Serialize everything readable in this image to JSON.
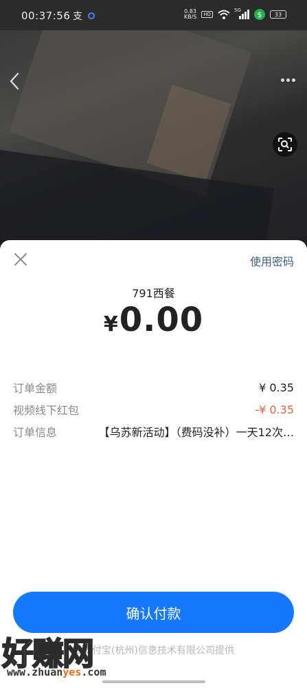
{
  "status_bar": {
    "time": "00:37:56",
    "app_indicator": "支",
    "net_speed": "0.83",
    "net_unit": "KB/S",
    "hd_badge": "HD",
    "signal_label": "5G",
    "battery": "33"
  },
  "camera": {
    "back_icon": "chevron-left-icon",
    "more_icon": "more-dots-icon",
    "scan_icon": "scan-search-icon"
  },
  "sheet": {
    "close_icon": "close-icon",
    "use_password_label": "使用密码",
    "merchant_name": "791西餐",
    "currency_symbol": "¥",
    "amount": "0.00",
    "rows": [
      {
        "label": "订单金额",
        "value": "¥ 0.35"
      },
      {
        "label": "视频线下红包",
        "value": "-¥ 0.35"
      },
      {
        "label": "订单信息",
        "value": "【乌苏新活动】（费码没补）一天12次…"
      }
    ],
    "confirm_label": "确认付款",
    "provider_text": "由支付宝(杭州)信息技术有限公司提供"
  },
  "watermark": {
    "title": "好赚网",
    "url_prefix": "www.zhuan",
    "url_highlight": "yes",
    "url_suffix": ".com"
  },
  "colors": {
    "accent": "#1677ff",
    "discount": "#e8603a",
    "link": "#3b5d84"
  }
}
